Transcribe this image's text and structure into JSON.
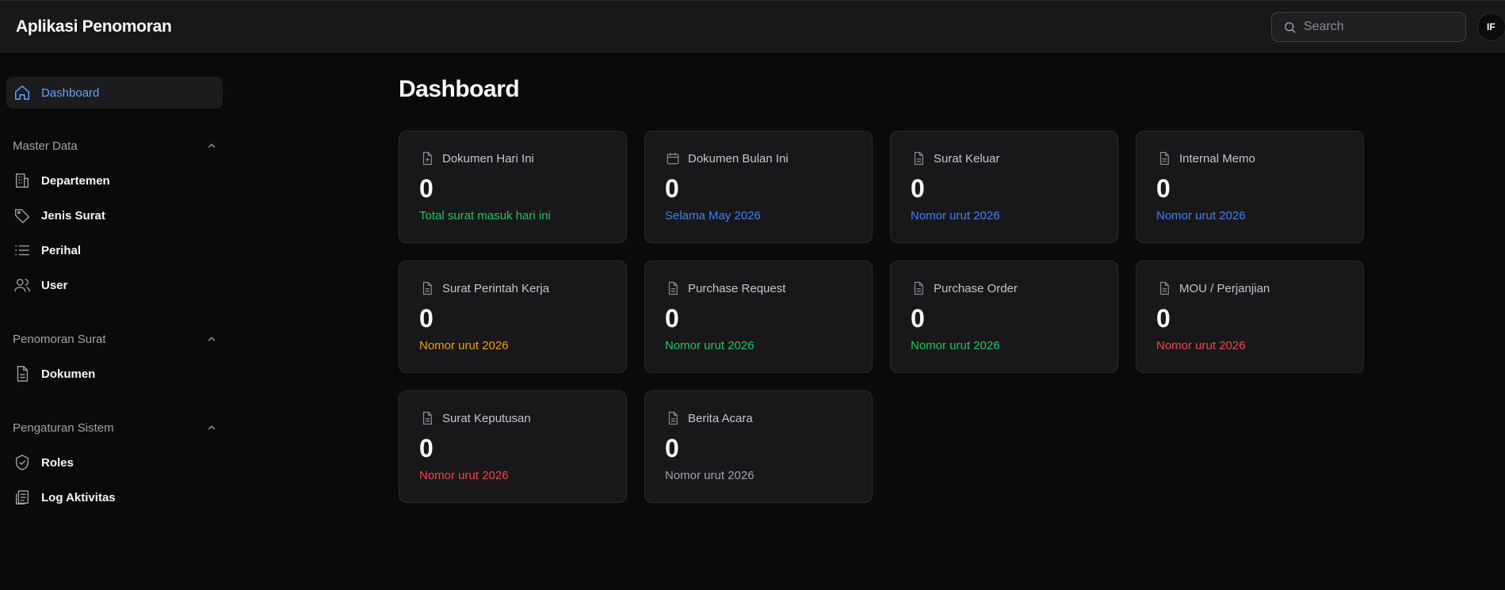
{
  "app": {
    "title": "Aplikasi Penomoran"
  },
  "search": {
    "placeholder": "Search"
  },
  "user": {
    "initials": "IF"
  },
  "sidebar": {
    "dashboard": "Dashboard",
    "master_data": {
      "title": "Master Data",
      "items": [
        "Departemen",
        "Jenis Surat",
        "Perihal",
        "User"
      ]
    },
    "penomoran": {
      "title": "Penomoran Surat",
      "items": [
        "Dokumen"
      ]
    },
    "pengaturan": {
      "title": "Pengaturan Sistem",
      "items": [
        "Roles",
        "Log Aktivitas"
      ]
    }
  },
  "page": {
    "title": "Dashboard"
  },
  "colors": {
    "blue": "#3b82f6",
    "green": "#22c55e",
    "orange": "#f59e0b",
    "red": "#ef4444",
    "gray": "#a1a1aa"
  },
  "cards": [
    {
      "label": "Dokumen Hari Ini",
      "value": "0",
      "sub": "Total surat masuk hari ini",
      "color": "green",
      "icon": "file-plus-icon"
    },
    {
      "label": "Dokumen Bulan Ini",
      "value": "0",
      "sub": "Selama May 2026",
      "color": "blue",
      "icon": "calendar-icon"
    },
    {
      "label": "Surat Keluar",
      "value": "0",
      "sub": "Nomor urut 2026",
      "color": "blue",
      "icon": "file-text-icon"
    },
    {
      "label": "Internal Memo",
      "value": "0",
      "sub": "Nomor urut 2026",
      "color": "blue",
      "icon": "file-text-icon"
    },
    {
      "label": "Surat Perintah Kerja",
      "value": "0",
      "sub": "Nomor urut 2026",
      "color": "orange",
      "icon": "file-text-icon"
    },
    {
      "label": "Purchase Request",
      "value": "0",
      "sub": "Nomor urut 2026",
      "color": "green",
      "icon": "file-text-icon"
    },
    {
      "label": "Purchase Order",
      "value": "0",
      "sub": "Nomor urut 2026",
      "color": "green",
      "icon": "file-text-icon"
    },
    {
      "label": "MOU / Perjanjian",
      "value": "0",
      "sub": "Nomor urut 2026",
      "color": "red",
      "icon": "file-text-icon"
    },
    {
      "label": "Surat Keputusan",
      "value": "0",
      "sub": "Nomor urut 2026",
      "color": "red",
      "icon": "file-text-icon"
    },
    {
      "label": "Berita Acara",
      "value": "0",
      "sub": "Nomor urut 2026",
      "color": "gray",
      "icon": "file-text-icon"
    }
  ]
}
